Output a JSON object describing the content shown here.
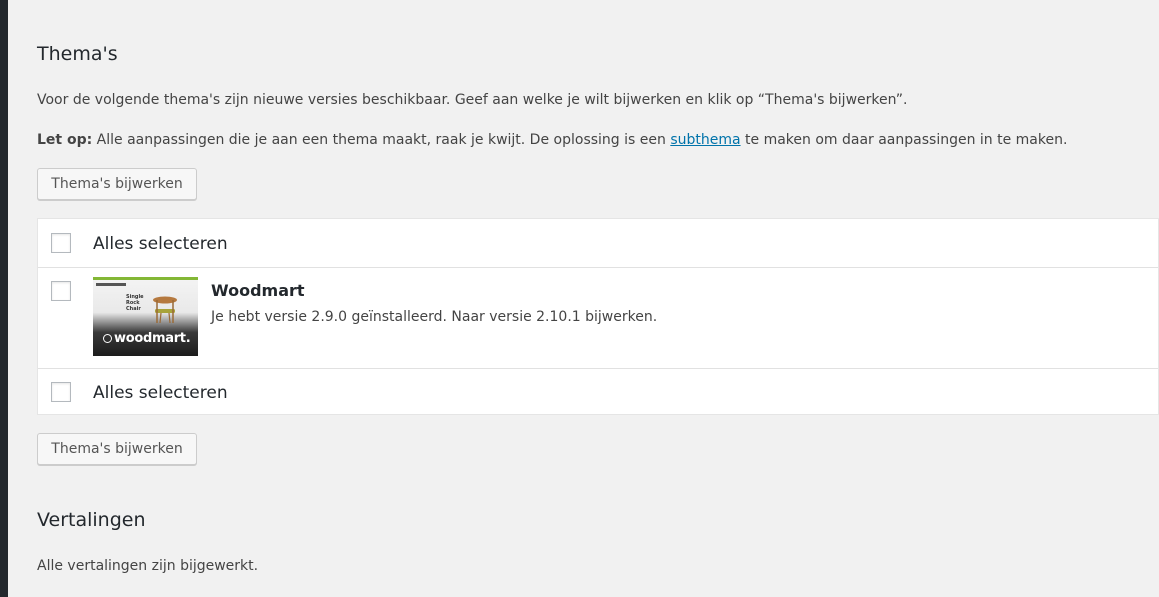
{
  "themes_section": {
    "title": "Thema's",
    "intro": "Voor de volgende thema's zijn nieuwe versies beschikbaar. Geef aan welke je wilt bijwerken en klik op “Thema's bijwerken”.",
    "note_label": "Let op:",
    "note_text_before": " Alle aanpassingen die je aan een thema maakt, raak je kwijt. De oplossing is een ",
    "note_link": "subthema",
    "note_text_after": " te maken om daar aanpassingen in te maken.",
    "update_button_label": "Thema's bijwerken",
    "select_all_label": "Alles selecteren",
    "themes": [
      {
        "name": "Woodmart",
        "description": "Je hebt versie 2.9.0 geïnstalleerd. Naar versie 2.10.1 bijwerken.",
        "thumbnail_logo": "woodmart.",
        "thumbnail_hero": "Single Rock Chair"
      }
    ]
  },
  "translations_section": {
    "title": "Vertalingen",
    "status": "Alle vertalingen zijn bijgewerkt."
  },
  "colors": {
    "background": "#f1f1f1",
    "admin_bar": "#23282d",
    "link": "#0073aa",
    "brand_green": "#83b735"
  }
}
